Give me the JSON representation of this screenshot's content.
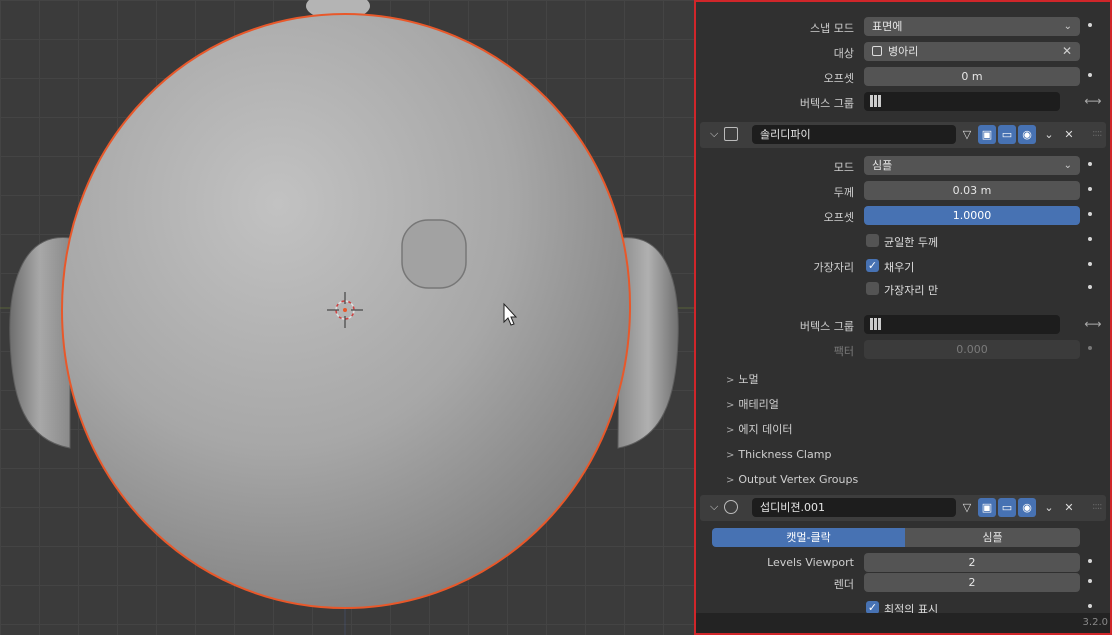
{
  "top_section": {
    "snap_mode_label": "스냅 모드",
    "snap_mode_value": "표면에",
    "target_label": "대상",
    "target_value": "병아리",
    "offset_label": "오프셋",
    "offset_value": "0 m",
    "vertex_group_label": "버텍스 그룹"
  },
  "solidify": {
    "name": "솔리디파이",
    "mode_label": "모드",
    "mode_value": "심플",
    "thickness_label": "두께",
    "thickness_value": "0.03 m",
    "offset_label": "오프셋",
    "offset_value": "1.0000",
    "even_thickness_label": "균일한 두께",
    "edge_label": "가장자리",
    "fill_label": "채우기",
    "rim_only_label": "가장자리 만",
    "vertex_group_label": "버텍스 그룹",
    "factor_label": "팩터",
    "factor_value": "0.000",
    "subpanels": [
      "노멀",
      "매테리얼",
      "에지 데이터",
      "Thickness Clamp",
      "Output Vertex Groups"
    ]
  },
  "subdivision": {
    "name": "섭디비젼.001",
    "tab_catmull": "캣멀-클락",
    "tab_simple": "심플",
    "levels_viewport_label": "Levels Viewport",
    "levels_viewport_value": "2",
    "render_label": "렌더",
    "render_value": "2",
    "optimal_display_label": "최적의 표시"
  },
  "version": "3.2.0",
  "colors": {
    "accent_blue": "#4772b3",
    "selection_outline": "#e8582a",
    "panel_highlight_border": "#d0262a"
  },
  "icons": {
    "dropdown": "chevron-down-icon",
    "clear": "close-icon",
    "checkmark": "check-icon"
  }
}
